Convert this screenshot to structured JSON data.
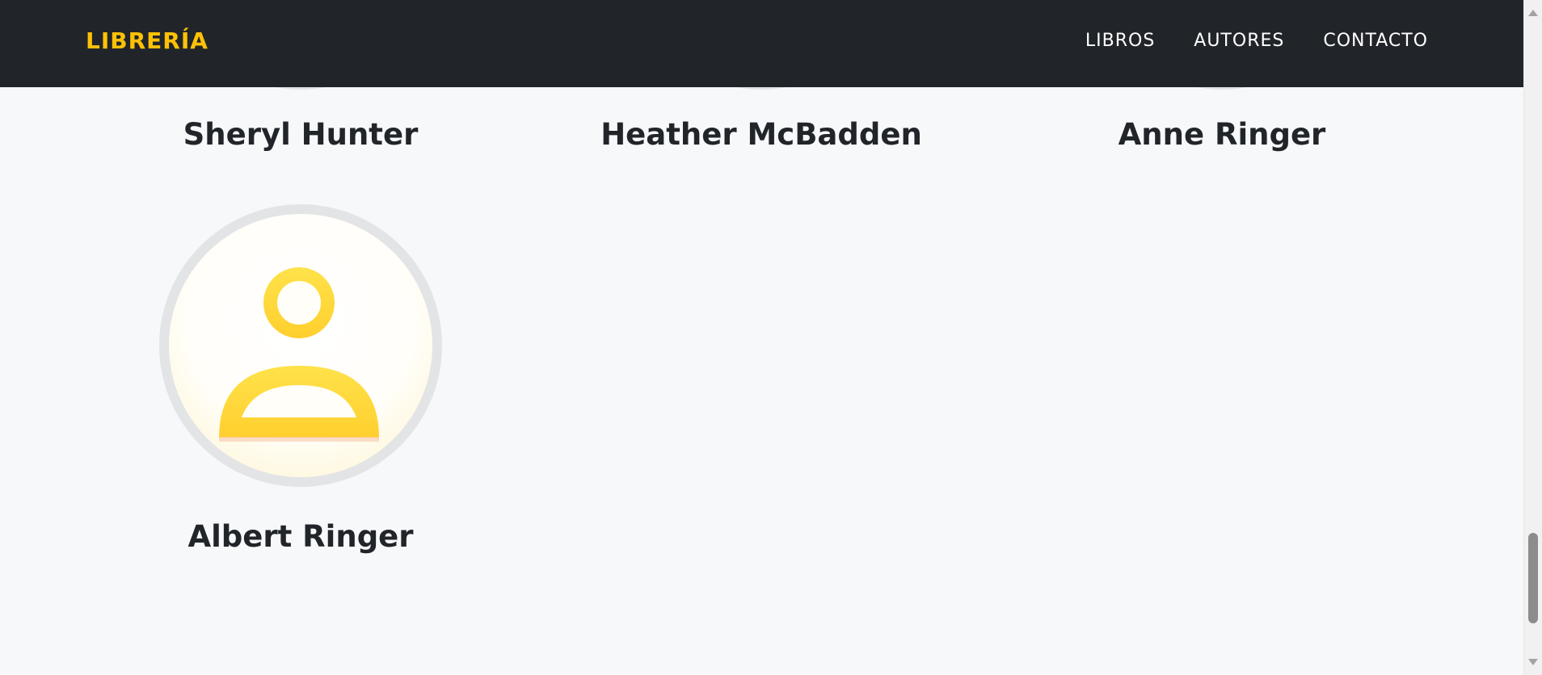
{
  "navbar": {
    "brand": "LIBRERÍA",
    "brand_color": "#ffc107",
    "background": "#212529",
    "links": [
      {
        "label": "LIBROS"
      },
      {
        "label": "AUTORES"
      },
      {
        "label": "CONTACTO"
      }
    ]
  },
  "authors": [
    {
      "name": "Sheryl Hunter"
    },
    {
      "name": "Heather McBadden"
    },
    {
      "name": "Anne Ringer"
    },
    {
      "name": "Albert Ringer",
      "avatar_icon": "user-icon"
    }
  ],
  "colors": {
    "page_background": "#f6f8fa",
    "avatar_icon": "#ffd83a",
    "text": "#212529"
  }
}
